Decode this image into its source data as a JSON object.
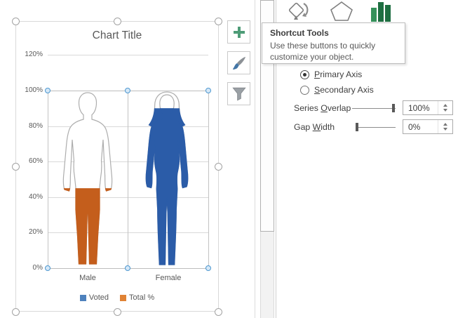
{
  "chart": {
    "title": "Chart Title",
    "y_ticks": [
      "120%",
      "100%",
      "80%",
      "60%",
      "40%",
      "20%",
      "0%"
    ],
    "categories": [
      "Male",
      "Female"
    ],
    "legend": [
      {
        "label": "Voted",
        "color": "#4E81BD"
      },
      {
        "label": "Total %",
        "color": "#E08234"
      }
    ]
  },
  "chart_data": {
    "type": "bar",
    "subtype": "pictograph - human silhouettes filled to value (series overlap 100%, gap width 0%)",
    "title": "Chart Title",
    "categories": [
      "Male",
      "Female"
    ],
    "series": [
      {
        "name": "Voted",
        "color": "#2B5CA8",
        "legend_color": "#4E81BD",
        "values": [
          null,
          90
        ]
      },
      {
        "name": "Total %",
        "color": "#C45E1C",
        "legend_color": "#E08234",
        "values": [
          45,
          null
        ]
      }
    ],
    "ylim": [
      0,
      120
    ],
    "ytick_interval": 20,
    "ytick_format": "percent",
    "grid": true,
    "legend_position": "bottom"
  },
  "tooltip": {
    "title": "Shortcut Tools",
    "line1": "Use these buttons to quickly",
    "line2": "customize your object."
  },
  "pane": {
    "primary_axis": {
      "pre": "",
      "key": "P",
      "post": "rimary Axis"
    },
    "secondary_axis": {
      "pre": "",
      "key": "S",
      "post": "econdary Axis"
    },
    "series_overlap": {
      "label_pre": "Series ",
      "label_key": "O",
      "label_post": "verlap",
      "value": "100%"
    },
    "gap_width": {
      "label_pre": "Gap ",
      "label_key": "W",
      "label_post": "idth",
      "value": "0%"
    }
  }
}
